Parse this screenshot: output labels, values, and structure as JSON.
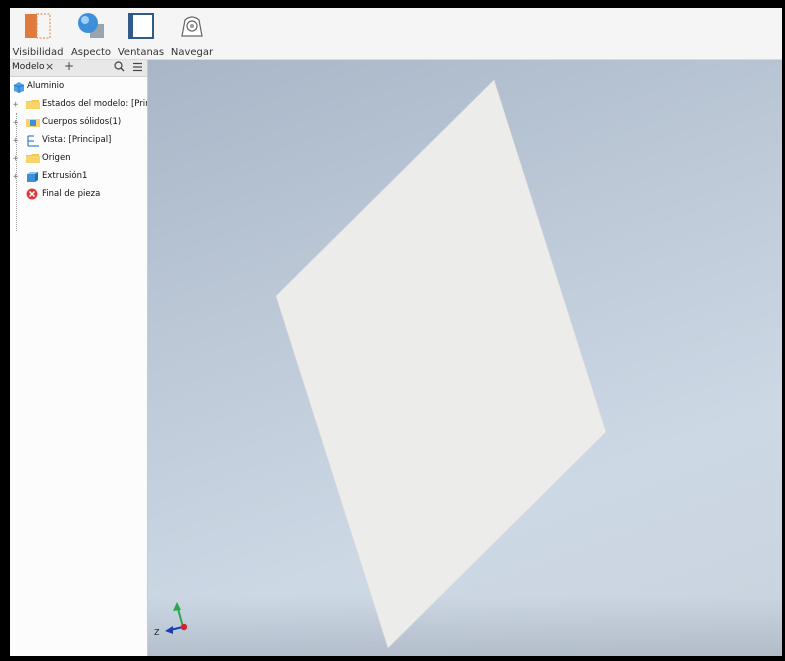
{
  "ribbon": {
    "buttons": [
      {
        "label": "Visibilidad",
        "icon": "visibility-icon"
      },
      {
        "label": "Aspecto",
        "icon": "appearance-icon"
      },
      {
        "label": "Ventanas",
        "icon": "windows-icon"
      },
      {
        "label": "Navegar",
        "icon": "navigate-icon"
      }
    ]
  },
  "browser": {
    "tab_label": "Modelo",
    "close_glyph": "×",
    "add_glyph": "+",
    "tree": [
      {
        "label": "Aluminio",
        "icon": "part-icon",
        "expandable": false
      },
      {
        "label": "Estados del modelo: [Princ",
        "icon": "folder-icon",
        "expandable": true
      },
      {
        "label": "Cuerpos sólidos(1)",
        "icon": "solid-bodies-icon",
        "expandable": true
      },
      {
        "label": "Vista: [Principal]",
        "icon": "view-icon",
        "expandable": true
      },
      {
        "label": "Origen",
        "icon": "folder-icon",
        "expandable": true
      },
      {
        "label": "Extrusión1",
        "icon": "extrusion-icon",
        "expandable": true
      },
      {
        "label": "Final de pieza",
        "icon": "end-of-part-icon",
        "expandable": false
      }
    ]
  },
  "viewport": {
    "axis_label_z": "Z",
    "colors": {
      "face": "#ececeb",
      "bg_top": "#a8b6c8",
      "bg_bottom": "#cdd8e5"
    }
  }
}
